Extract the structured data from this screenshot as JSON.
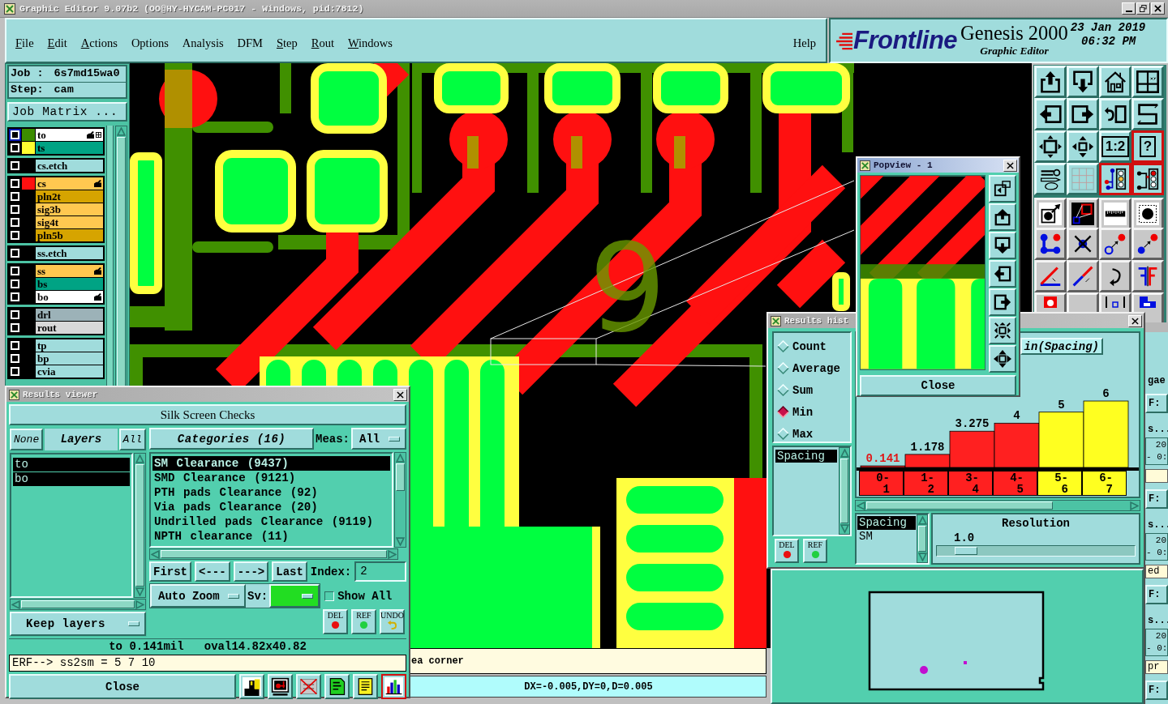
{
  "window": {
    "title": "Graphic Editor 9.07b2 (OO@HY-HYCAM-PC017 - Windows, pid:7812)"
  },
  "menu": {
    "items": [
      {
        "label": "File",
        "mnemonic": true
      },
      {
        "label": "Edit",
        "mnemonic": true
      },
      {
        "label": "Actions",
        "mnemonic": true
      },
      {
        "label": "Options",
        "mnemonic": false
      },
      {
        "label": "Analysis",
        "mnemonic": false
      },
      {
        "label": "DFM",
        "mnemonic": false
      },
      {
        "label": "Step",
        "mnemonic": true
      },
      {
        "label": "Rout",
        "mnemonic": true
      },
      {
        "label": "Windows",
        "mnemonic": true
      }
    ],
    "help": {
      "label": "Help",
      "mnemonic": false
    }
  },
  "logo": {
    "brand": "Frontline",
    "product": "Genesis 2000",
    "subtitle": "Graphic Editor",
    "date": "23 Jan 2019",
    "time": "06:32 PM"
  },
  "job": {
    "job_label": "Job :",
    "job": "6s7md15wa0",
    "step_label": "Step:",
    "step": "cam",
    "matrix_button": "Job Matrix ..."
  },
  "layer_groups": [
    {
      "layers": [
        {
          "name": "to",
          "kind": "silkscreen",
          "color": "#3c8c00",
          "checked": false,
          "work": true,
          "affected": true
        },
        {
          "name": "ts",
          "kind": "soldermask",
          "color": "#ffff30",
          "checked": false,
          "work": false,
          "affected": false
        }
      ]
    },
    {
      "layers": [
        {
          "name": "cs.etch",
          "kind": "document",
          "checked": false,
          "work": false,
          "affected": false
        }
      ]
    },
    {
      "layers": [
        {
          "name": "cs",
          "kind": "signal",
          "color": "#ff1010",
          "checked": false,
          "work": false,
          "affected": true
        },
        {
          "name": "pln2t",
          "kind": "powerground",
          "checked": false,
          "work": false,
          "affected": false
        },
        {
          "name": "sig3b",
          "kind": "signal",
          "checked": false,
          "work": false,
          "affected": false
        },
        {
          "name": "sig4t",
          "kind": "signal",
          "checked": false,
          "work": false,
          "affected": false
        },
        {
          "name": "pln5b",
          "kind": "powerground",
          "checked": false,
          "work": false,
          "affected": false
        }
      ]
    },
    {
      "layers": [
        {
          "name": "ss.etch",
          "kind": "document",
          "checked": false,
          "work": false,
          "affected": false
        }
      ]
    },
    {
      "layers": [
        {
          "name": "ss",
          "kind": "signal",
          "checked": false,
          "work": false,
          "affected": true
        },
        {
          "name": "bs",
          "kind": "soldermask",
          "checked": false,
          "work": false,
          "affected": false
        },
        {
          "name": "bo",
          "kind": "silkscreen",
          "checked": false,
          "work": false,
          "affected": true
        }
      ]
    },
    {
      "layers": [
        {
          "name": "drl",
          "kind": "drill",
          "checked": false,
          "work": false,
          "affected": false
        },
        {
          "name": "rout",
          "kind": "rout",
          "checked": false,
          "work": false,
          "affected": false
        }
      ]
    },
    {
      "layers": [
        {
          "name": "tp",
          "kind": "document",
          "checked": false,
          "work": false,
          "affected": false
        },
        {
          "name": "bp",
          "kind": "document",
          "checked": false,
          "work": false,
          "affected": false
        },
        {
          "name": "cvia",
          "kind": "document",
          "checked": false,
          "work": false,
          "affected": false
        }
      ]
    }
  ],
  "canvas": {
    "silk_label": "9"
  },
  "toolbar": {
    "buttons": [
      {
        "on": false
      },
      {
        "on": false
      },
      {
        "on": false
      },
      {
        "on": false
      },
      {
        "on": false
      },
      {
        "on": false
      },
      {
        "on": false
      },
      {
        "on": false
      },
      {
        "on": false
      },
      {
        "on": false
      },
      {
        "label": "1:2",
        "on": false
      },
      {
        "label": "?",
        "on": true
      },
      {
        "on": false
      },
      {
        "on": false
      },
      {
        "on": true
      },
      {
        "on": true
      },
      {
        "on": false
      },
      {
        "on": false
      },
      {
        "on": false
      },
      {
        "on": false
      },
      {
        "on": false
      },
      {
        "on": false
      },
      {
        "on": false
      },
      {
        "on": false
      },
      {
        "on": false
      },
      {
        "on": false
      },
      {
        "on": false
      },
      {
        "on": false
      },
      {
        "on": false
      },
      {
        "on": false
      },
      {
        "on": false
      },
      {
        "on": false
      }
    ]
  },
  "popview": {
    "title": "Popview - 1",
    "close": "Close"
  },
  "histogram": {
    "title": "Results hist",
    "modes": [
      {
        "label": "Count",
        "selected": false
      },
      {
        "label": "Average",
        "selected": false
      },
      {
        "label": "Sum",
        "selected": false
      },
      {
        "label": "Min",
        "selected": true
      },
      {
        "label": "Max",
        "selected": false
      }
    ],
    "measures": [
      {
        "label": "Spacing",
        "selected": true
      }
    ],
    "edit_buttons": [
      "DEL",
      "REF"
    ],
    "chart_button": "in(Spacing)",
    "chart_data": {
      "type": "bar",
      "categories": [
        "0-1",
        "1-2",
        "3-4",
        "4-5",
        "5-6",
        "6-7"
      ],
      "series": [
        {
          "color": "#ff2020",
          "values": [
            0.141,
            1.178,
            3.275,
            4,
            null,
            null
          ]
        },
        {
          "color": "#ffff20",
          "values": [
            null,
            null,
            null,
            null,
            5,
            6
          ]
        }
      ],
      "data_labels": true
    },
    "bins": [
      {
        "selected": true
      },
      {
        "selected": false
      },
      {
        "selected": false
      },
      {
        "selected": false
      },
      {
        "selected": false
      },
      {
        "selected": false
      }
    ],
    "series_list": [
      {
        "label": "Spacing",
        "selected": true
      },
      {
        "label": "SM",
        "selected": false
      }
    ],
    "resolution_label": "Resolution",
    "resolution_value": "1.0",
    "resolution_slider": {
      "level": 0.1
    }
  },
  "results_viewer": {
    "title": "Results viewer",
    "check_set": "Silk Screen Checks",
    "none_button": "None",
    "layers_header": "Layers",
    "all_button": "All",
    "layers": [
      {
        "name": "to",
        "selected": true
      },
      {
        "name": "bo",
        "selected": true
      }
    ],
    "keep_option": "Keep layers",
    "categories_button": "Categories (16)",
    "meas_label": "Meas:",
    "meas_value": "All",
    "categories": [
      {
        "label": "SM Clearance (9437)",
        "selected": true
      },
      {
        "label": "SMD Clearance (9121)",
        "selected": false
      },
      {
        "label": "PTH pads Clearance (92)",
        "selected": false
      },
      {
        "label": "Via pads Clearance (20)",
        "selected": false
      },
      {
        "label": "Undrilled pads Clearance (9119)",
        "selected": false
      },
      {
        "label": "NPTH clearance (11)",
        "selected": false
      }
    ],
    "nav_buttons": [
      "First",
      "<---",
      "--->",
      "Last"
    ],
    "index_label": "Index:",
    "index_value": "2",
    "zoom_option": "Auto Zoom",
    "sv_label": "Sv:",
    "severity_menu": {
      "color": "#22dd22"
    },
    "show_all": {
      "label": "Show All",
      "checked": false
    },
    "edit_buttons": [
      "DEL",
      "REF",
      "UNDO"
    ],
    "info": "to 0.141mil   oval14.82x40.82",
    "erf": "ERF--> ss2sm = 5 7 10",
    "close": "Close",
    "tools": [
      {
        "on": false
      },
      {
        "on": false
      },
      {
        "on": false
      },
      {
        "on": false
      },
      {
        "on": false
      },
      {
        "on": true
      }
    ]
  },
  "prompt": "ea corner",
  "status": "DX=-0.005,DY=0,D=0.005",
  "side_window": {
    "items": [
      {
        "kind": "label",
        "text": "gae"
      },
      {
        "kind": "button",
        "text": "F:"
      },
      {
        "kind": "label",
        "text": "s..."
      },
      {
        "kind": "stamp",
        "lines": [
          "20",
          "- 0:"
        ]
      },
      {
        "kind": "field"
      },
      {
        "kind": "button",
        "text": "F:"
      },
      {
        "kind": "label",
        "text": "s..."
      },
      {
        "kind": "stamp",
        "lines": [
          "20",
          "- 0:"
        ]
      },
      {
        "kind": "field",
        "text": "ed"
      },
      {
        "kind": "button",
        "text": "F:"
      },
      {
        "kind": "label",
        "text": "s..."
      },
      {
        "kind": "stamp",
        "lines": [
          "20",
          "- 0:"
        ]
      },
      {
        "kind": "field",
        "text": "pr"
      },
      {
        "kind": "button",
        "text": "F:"
      }
    ]
  }
}
